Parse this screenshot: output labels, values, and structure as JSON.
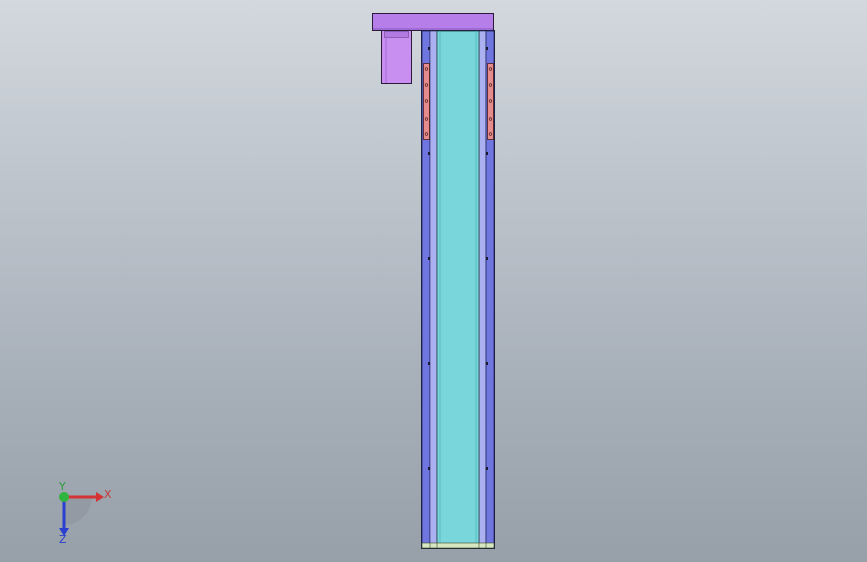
{
  "viewport": {
    "background_top": "#d3d8de",
    "background_bottom": "#979fa9"
  },
  "model": {
    "parts": [
      {
        "name": "motor-mount-plate",
        "color": "#b67ee9"
      },
      {
        "name": "motor-body",
        "color": "#c88ef0"
      },
      {
        "name": "rail-main-body",
        "color": "#79d6db"
      },
      {
        "name": "side-rail-left",
        "color": "#6f76e0"
      },
      {
        "name": "side-rail-right",
        "color": "#6f76e0"
      },
      {
        "name": "carriage-plate-left",
        "color": "#e58b8b"
      },
      {
        "name": "carriage-plate-right",
        "color": "#e58b8b"
      },
      {
        "name": "end-cap-bottom",
        "color": "#d7e7c2"
      }
    ]
  },
  "triad": {
    "x_label": "X",
    "y_label": "Y",
    "z_label": "Z",
    "x_color": "#d43434",
    "y_color": "#2fb53e",
    "z_color": "#2a3fd0"
  }
}
